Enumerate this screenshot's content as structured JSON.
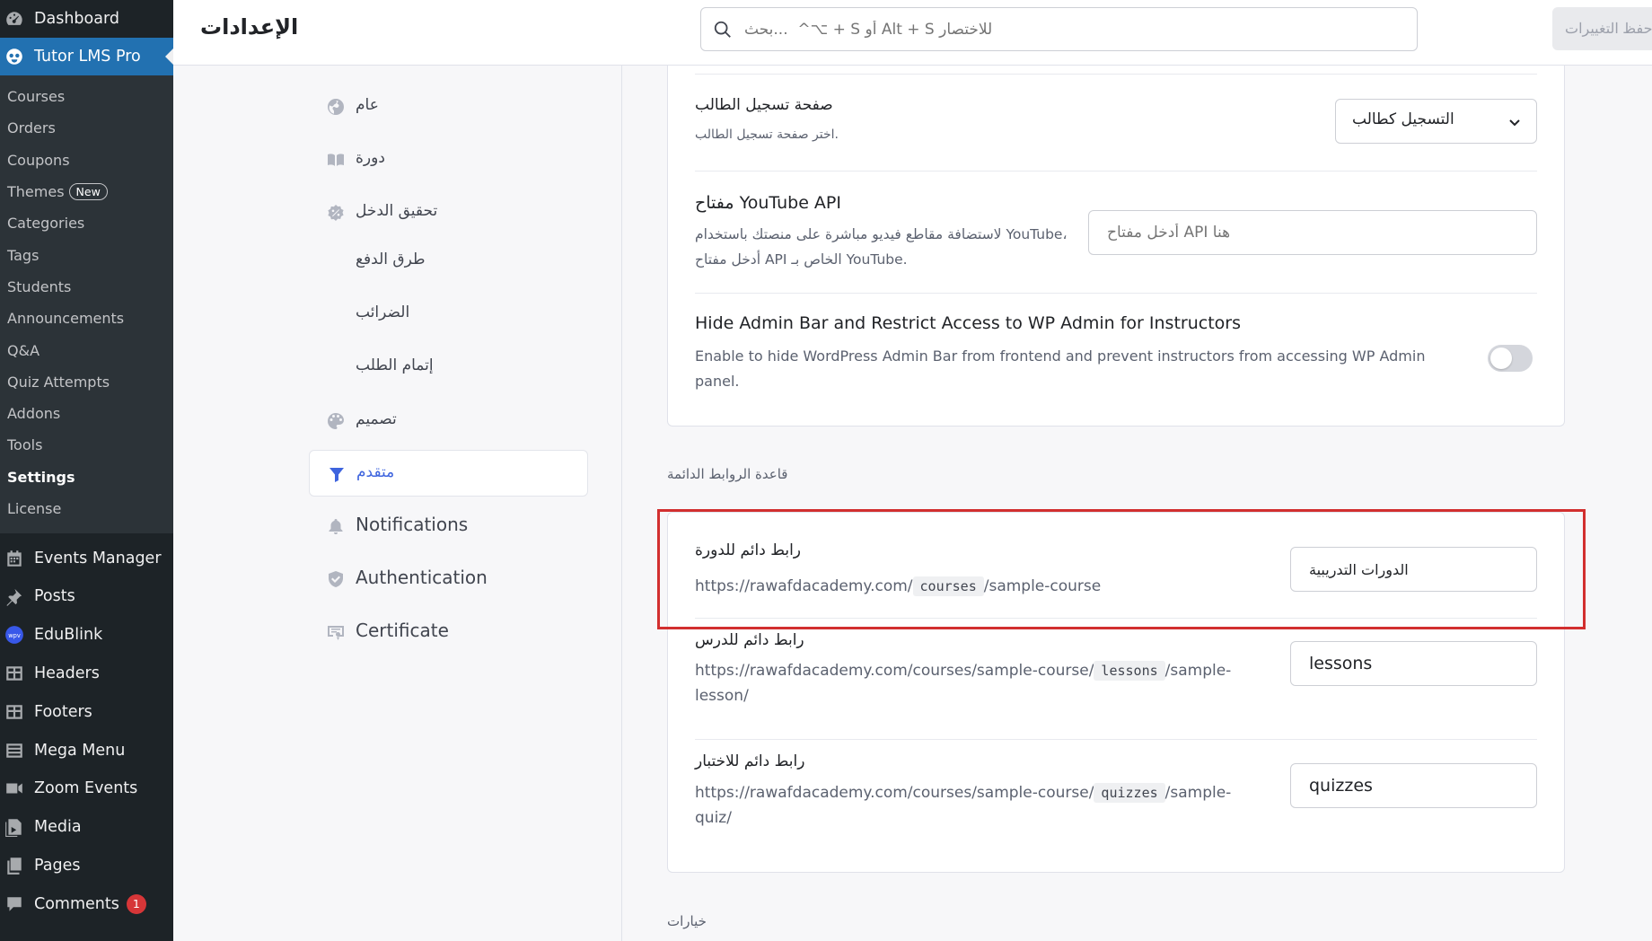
{
  "wp_menu": {
    "dashboard": "Dashboard",
    "tutor": "Tutor LMS Pro",
    "submenu": [
      {
        "label": "Courses"
      },
      {
        "label": "Orders"
      },
      {
        "label": "Coupons"
      },
      {
        "label": "Themes",
        "badge": "New"
      },
      {
        "label": "Categories"
      },
      {
        "label": "Tags"
      },
      {
        "label": "Students"
      },
      {
        "label": "Announcements"
      },
      {
        "label": "Q&A"
      },
      {
        "label": "Quiz Attempts"
      },
      {
        "label": "Addons"
      },
      {
        "label": "Tools"
      },
      {
        "label": "Settings"
      },
      {
        "label": "License"
      }
    ],
    "lower": [
      {
        "label": "Events Manager",
        "icon": "calendar-icon"
      },
      {
        "label": "Posts",
        "icon": "pin-icon"
      },
      {
        "label": "EduBlink",
        "icon": "wpv-logo-icon"
      },
      {
        "label": "Headers",
        "icon": "table-icon"
      },
      {
        "label": "Footers",
        "icon": "table-icon"
      },
      {
        "label": "Mega Menu",
        "icon": "list-icon"
      },
      {
        "label": "Zoom Events",
        "icon": "video-icon"
      },
      {
        "label": "Media",
        "icon": "media-icon"
      },
      {
        "label": "Pages",
        "icon": "pages-icon"
      },
      {
        "label": "Comments",
        "icon": "comment-icon",
        "count": "1"
      }
    ]
  },
  "topbar": {
    "title": "الإعدادات",
    "search_placeholder": "بحث...  ^⌥ + S أو Alt + S للاختصار",
    "save_label": "حفظ التغييرات"
  },
  "settings_nav": [
    {
      "label": "عام",
      "icon": "globe-icon"
    },
    {
      "label": "دورة",
      "icon": "book-icon"
    },
    {
      "label": "تحقيق الدخل",
      "icon": "monetization-icon"
    },
    {
      "label": "طرق الدفع"
    },
    {
      "label": "الضرائب"
    },
    {
      "label": "إتمام الطلب"
    },
    {
      "label": "تصميم",
      "icon": "palette-icon"
    },
    {
      "label": "متقدم",
      "icon": "filter-icon",
      "active": true
    },
    {
      "label": "Notifications",
      "icon": "bell-icon"
    },
    {
      "label": "Authentication",
      "icon": "shield-icon"
    },
    {
      "label": "Certificate",
      "icon": "certificate-icon"
    }
  ],
  "general_card": {
    "student_reg": {
      "title": "صفحة تسجيل الطالب",
      "desc": "اختر صفحة تسجيل الطالب.",
      "value": "التسجيل كطالب"
    },
    "youtube": {
      "title": "مفتاح YouTube API",
      "desc_line1": "لاستضافة مقاطع فيديو مباشرة على منصتك باستخدام YouTube،",
      "desc_line2": "أدخل مفتاح API الخاص بـ YouTube.",
      "placeholder": "أدخل مفتاح API هنا"
    },
    "admin_bar": {
      "title": "Hide Admin Bar and Restrict Access to WP Admin for Instructors",
      "desc_line1": "Enable to hide WordPress Admin Bar from frontend and prevent instructors from accessing WP Admin",
      "desc_line2": "panel.",
      "enabled": false
    }
  },
  "permalinks": {
    "section_title": "قاعدة الروابط الدائمة",
    "course": {
      "title": "رابط دائم للدورة",
      "url_prefix": "https://rawafdacademy.com/",
      "slug": "courses",
      "url_suffix": "/sample-course",
      "value": "الدورات التدريبية"
    },
    "lesson": {
      "title": "رابط دائم للدرس",
      "url_prefix": "https://rawafdacademy.com/courses/sample-course/",
      "slug": "lessons",
      "url_suffix": "/sample-",
      "url_line2": "lesson/",
      "value": "lessons"
    },
    "quiz": {
      "title": "رابط دائم للاختبار",
      "url_prefix": "https://rawafdacademy.com/courses/sample-course/",
      "slug": "quizzes",
      "url_suffix": "/sample-",
      "url_line2": "quiz/",
      "value": "quizzes"
    }
  },
  "options_title": "خيارات",
  "colors": {
    "accent": "#3e64de",
    "wp_blue": "#2271b1",
    "highlight": "#d22f2f"
  }
}
